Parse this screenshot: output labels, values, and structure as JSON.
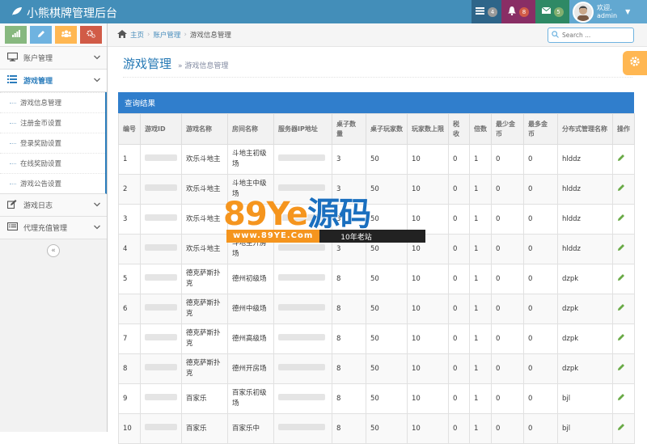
{
  "app": {
    "title": "小熊棋牌管理后台",
    "notifications": [
      {
        "icon": "tasks-icon",
        "count": "4",
        "bg": "#2e6589",
        "badge_color": "#9a9a9a"
      },
      {
        "icon": "bell-icon",
        "count": "8",
        "bg": "#892e65",
        "badge_color": "#d15b47"
      },
      {
        "icon": "envelope-icon",
        "count": "5",
        "bg": "#2e8965",
        "badge_color": "#82af6f"
      }
    ],
    "user": {
      "greeting": "欢迎,",
      "name": "admin"
    }
  },
  "shortcuts": [
    {
      "icon": "signal-icon",
      "color": "#87b87f"
    },
    {
      "icon": "pencil-icon",
      "color": "#6fb3e0"
    },
    {
      "icon": "group-icon",
      "color": "#ffb752"
    },
    {
      "icon": "cogs-icon",
      "color": "#d15b47"
    }
  ],
  "sidebar": {
    "items": [
      {
        "label": "账户管理",
        "icon": "desktop-icon"
      },
      {
        "label": "游戏管理",
        "icon": "list-icon",
        "active": true
      },
      {
        "label": "游戏日志",
        "icon": "edit-icon"
      },
      {
        "label": "代理充值管理",
        "icon": "list-alt-icon"
      }
    ],
    "submenu": [
      "游戏信息管理",
      "注册金币设置",
      "登录奖励设置",
      "在线奖励设置",
      "游戏公告设置"
    ],
    "collapse_symbol": "«"
  },
  "breadcrumbs": {
    "home": "主页",
    "level1": "账户管理",
    "current": "游戏信息管理"
  },
  "search": {
    "placeholder": "Search ..."
  },
  "page": {
    "title": "游戏管理",
    "subtitle": "» 游戏信息管理"
  },
  "results": {
    "title": "查询结果"
  },
  "table": {
    "headers": [
      "编号",
      "游戏ID",
      "游戏名称",
      "房间名称",
      "服务器IP地址",
      "桌子数量",
      "桌子玩家数",
      "玩家数上限",
      "税收",
      "倍数",
      "最少金币",
      "最多金币",
      "分布式管理名称",
      "操作"
    ],
    "rows": [
      {
        "no": "1",
        "game": "欢乐斗地主",
        "room": "斗地主初级场",
        "tables": "3",
        "players": "50",
        "limit": "10",
        "tax": "0",
        "mult": "1",
        "min": "0",
        "max": "0",
        "dist": "hlddz"
      },
      {
        "no": "2",
        "game": "欢乐斗地主",
        "room": "斗地主中级场",
        "tables": "3",
        "players": "50",
        "limit": "10",
        "tax": "0",
        "mult": "1",
        "min": "0",
        "max": "0",
        "dist": "hlddz"
      },
      {
        "no": "3",
        "game": "欢乐斗地主",
        "room": "",
        "tables": "3",
        "players": "50",
        "limit": "10",
        "tax": "0",
        "mult": "1",
        "min": "0",
        "max": "0",
        "dist": "hlddz"
      },
      {
        "no": "4",
        "game": "欢乐斗地主",
        "room": "斗地主开房场",
        "tables": "3",
        "players": "50",
        "limit": "10",
        "tax": "0",
        "mult": "1",
        "min": "0",
        "max": "0",
        "dist": "hlddz"
      },
      {
        "no": "5",
        "game": "德克萨斯扑克",
        "room": "德州初级场",
        "tables": "8",
        "players": "50",
        "limit": "10",
        "tax": "0",
        "mult": "1",
        "min": "0",
        "max": "0",
        "dist": "dzpk"
      },
      {
        "no": "6",
        "game": "德克萨斯扑克",
        "room": "德州中级场",
        "tables": "8",
        "players": "50",
        "limit": "10",
        "tax": "0",
        "mult": "1",
        "min": "0",
        "max": "0",
        "dist": "dzpk"
      },
      {
        "no": "7",
        "game": "德克萨斯扑克",
        "room": "德州高级场",
        "tables": "8",
        "players": "50",
        "limit": "10",
        "tax": "0",
        "mult": "1",
        "min": "0",
        "max": "0",
        "dist": "dzpk"
      },
      {
        "no": "8",
        "game": "德克萨斯扑克",
        "room": "德州开房场",
        "tables": "8",
        "players": "50",
        "limit": "10",
        "tax": "0",
        "mult": "1",
        "min": "0",
        "max": "0",
        "dist": "dzpk"
      },
      {
        "no": "9",
        "game": "百家乐",
        "room": "百家乐初级场",
        "tables": "8",
        "players": "50",
        "limit": "10",
        "tax": "0",
        "mult": "1",
        "min": "0",
        "max": "0",
        "dist": "bjl"
      },
      {
        "no": "10",
        "game": "百家乐",
        "room": "百家乐中",
        "tables": "8",
        "players": "50",
        "limit": "10",
        "tax": "0",
        "mult": "1",
        "min": "0",
        "max": "0",
        "dist": "bjl"
      }
    ],
    "action_icon": "pencil-icon"
  },
  "watermark": {
    "main": "89Ye",
    "cn": "源码",
    "url": "www.89YE.Com",
    "tag": "10年老站"
  }
}
